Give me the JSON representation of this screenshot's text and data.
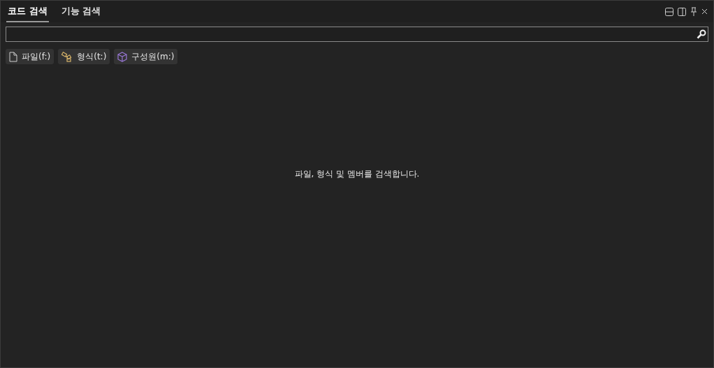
{
  "tabs": [
    {
      "label": "코드 검색",
      "selected": true
    },
    {
      "label": "기능 검색",
      "selected": false
    }
  ],
  "filters": [
    {
      "kind": "file",
      "label": "파일(f:)"
    },
    {
      "kind": "type",
      "label": "형식(t:)"
    },
    {
      "kind": "member",
      "label": "구성원(m:)"
    }
  ],
  "empty_message": "파일, 형식 및 멤버를 검색합니다."
}
